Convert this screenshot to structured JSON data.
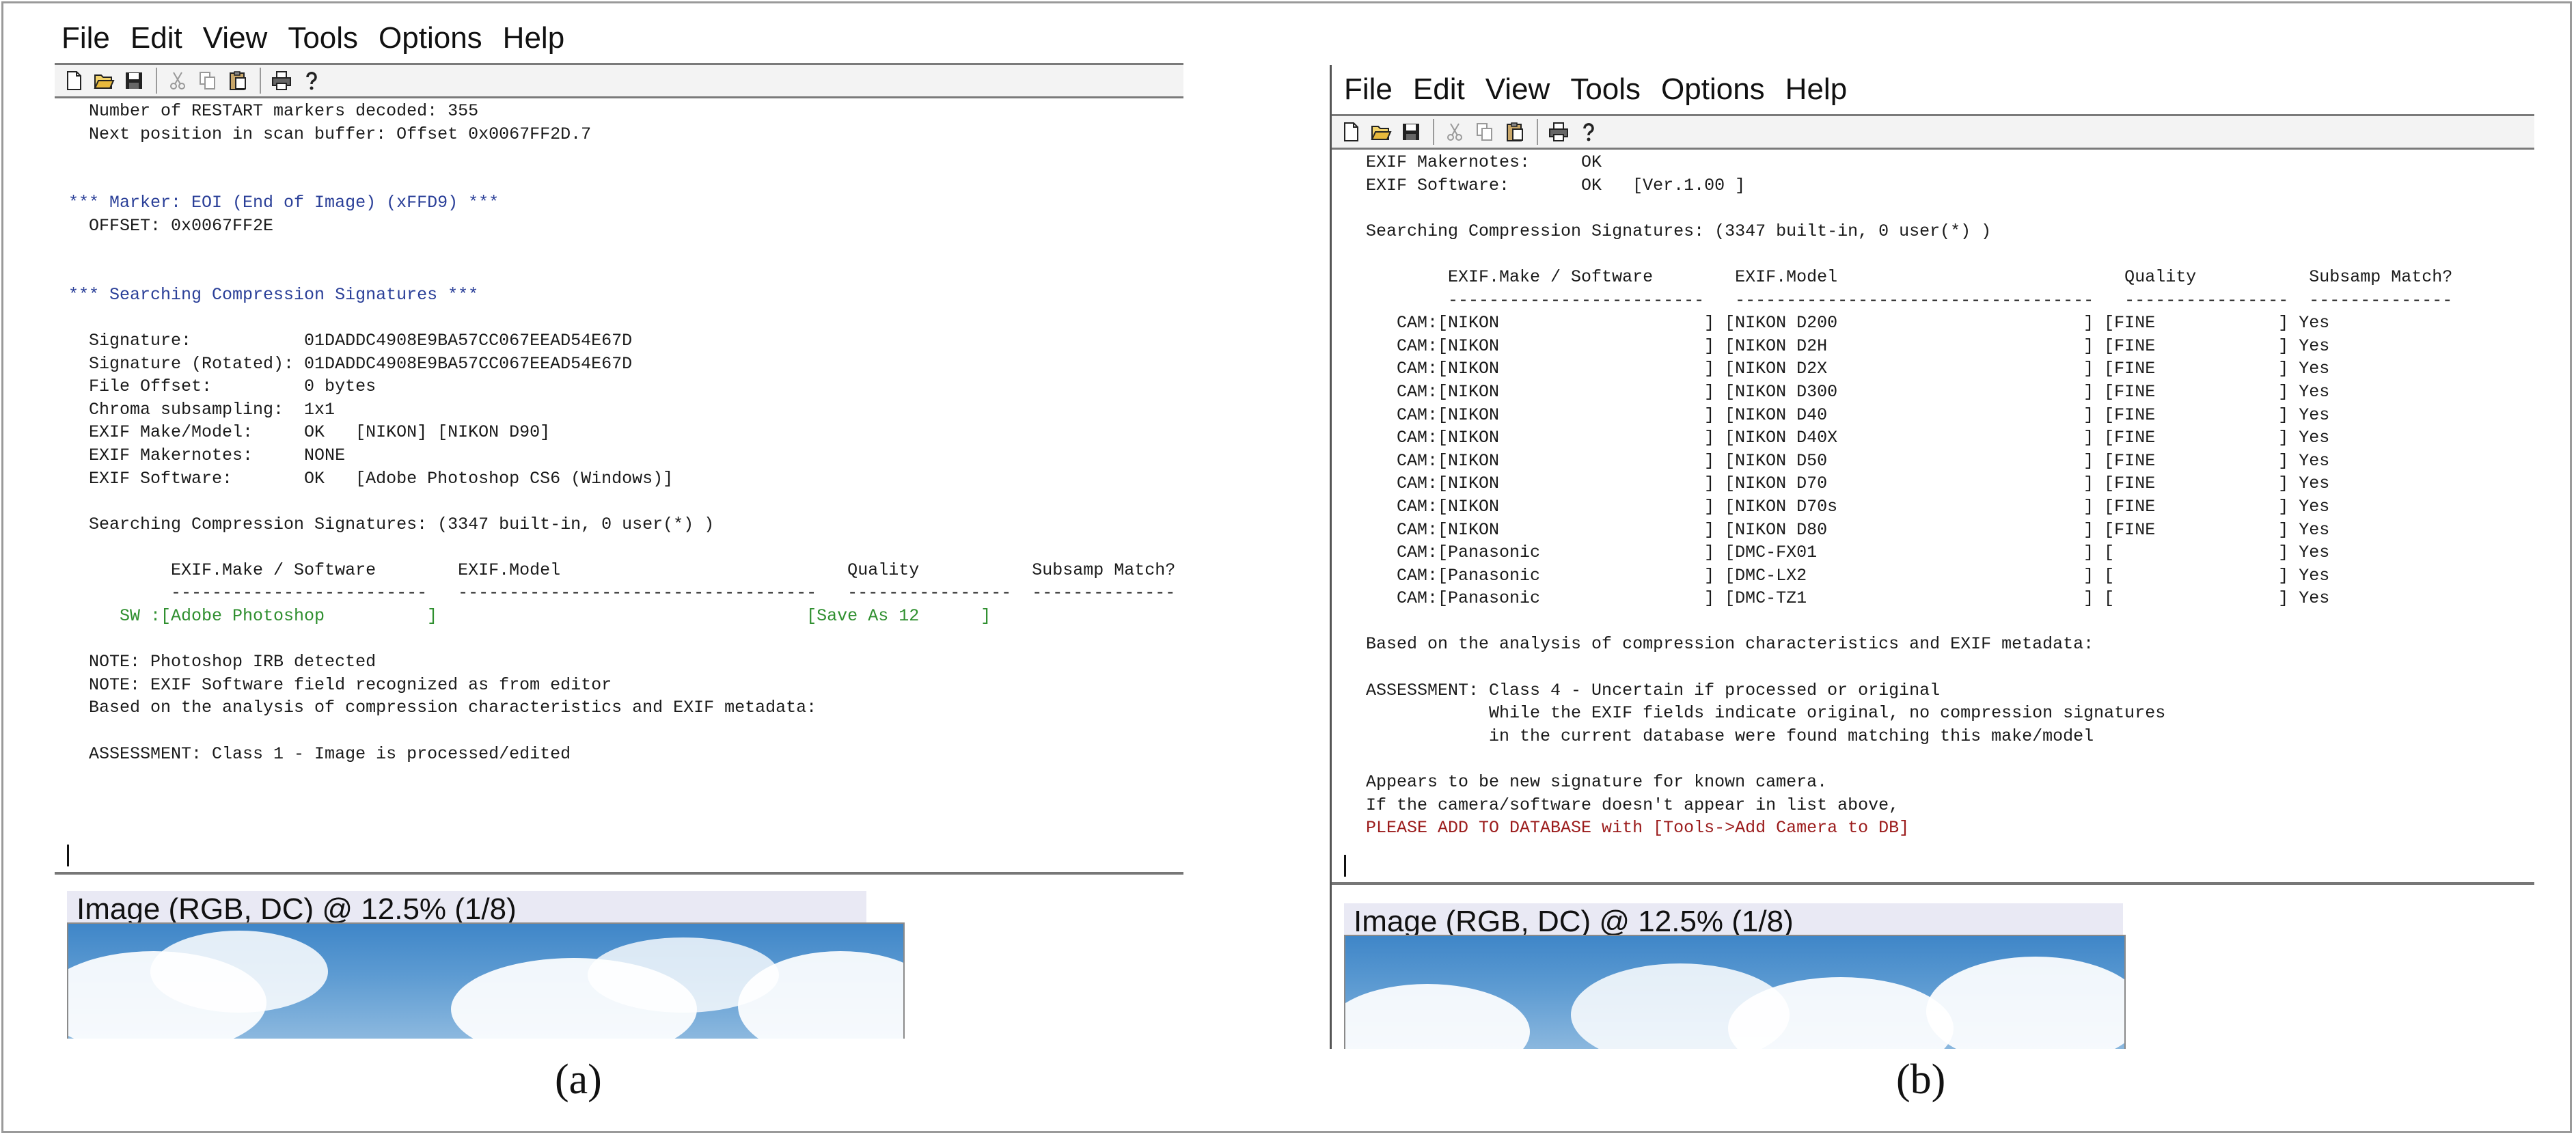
{
  "panels": [
    {
      "menu": [
        "File",
        "Edit",
        "View",
        "Tools",
        "Options",
        "Help"
      ],
      "log": [
        {
          "text": "  Number of RESTART markers decoded: 355",
          "style": "normal"
        },
        {
          "text": "  Next position in scan buffer: Offset 0x0067FF2D.7",
          "style": "normal"
        },
        {
          "text": "",
          "style": "normal"
        },
        {
          "text": "",
          "style": "normal"
        },
        {
          "text": "*** Marker: EOI (End of Image) (xFFD9) ***",
          "style": "marker"
        },
        {
          "text": "  OFFSET: 0x0067FF2E",
          "style": "normal"
        },
        {
          "text": "",
          "style": "normal"
        },
        {
          "text": "",
          "style": "normal"
        },
        {
          "text": "*** Searching Compression Signatures ***",
          "style": "marker"
        },
        {
          "text": "",
          "style": "normal"
        },
        {
          "text": "  Signature:           01DADDC4908E9BA57CC067EEAD54E67D",
          "style": "normal"
        },
        {
          "text": "  Signature (Rotated): 01DADDC4908E9BA57CC067EEAD54E67D",
          "style": "normal"
        },
        {
          "text": "  File Offset:         0 bytes",
          "style": "normal"
        },
        {
          "text": "  Chroma subsampling:  1x1",
          "style": "normal"
        },
        {
          "text": "  EXIF Make/Model:     OK   [NIKON] [NIKON D90]",
          "style": "normal"
        },
        {
          "text": "  EXIF Makernotes:     NONE",
          "style": "normal"
        },
        {
          "text": "  EXIF Software:       OK   [Adobe Photoshop CS6 (Windows)]",
          "style": "normal"
        },
        {
          "text": "",
          "style": "normal"
        },
        {
          "text": "  Searching Compression Signatures: (3347 built-in, 0 user(*) )",
          "style": "normal"
        },
        {
          "text": "",
          "style": "normal"
        },
        {
          "text": "          EXIF.Make / Software        EXIF.Model                            Quality           Subsamp Match?",
          "style": "normal"
        },
        {
          "text": "          -------------------------   -----------------------------------   ----------------  --------------",
          "style": "normal"
        },
        {
          "text": "     SW :[Adobe Photoshop          ]                                    [Save As 12      ]",
          "style": "green"
        },
        {
          "text": "",
          "style": "normal"
        },
        {
          "text": "  NOTE: Photoshop IRB detected",
          "style": "normal"
        },
        {
          "text": "  NOTE: EXIF Software field recognized as from editor",
          "style": "normal"
        },
        {
          "text": "  Based on the analysis of compression characteristics and EXIF metadata:",
          "style": "normal"
        },
        {
          "text": "",
          "style": "normal"
        },
        {
          "text": "  ASSESSMENT: Class 1 - Image is processed/edited",
          "style": "normal"
        }
      ],
      "preview_title": "Image (RGB, DC) @ 12.5% (1/8)",
      "caption": "(a)"
    },
    {
      "menu": [
        "File",
        "Edit",
        "View",
        "Tools",
        "Options",
        "Help"
      ],
      "log": [
        {
          "text": "  EXIF Makernotes:     OK",
          "style": "normal"
        },
        {
          "text": "  EXIF Software:       OK   [Ver.1.00 ]",
          "style": "normal"
        },
        {
          "text": "",
          "style": "normal"
        },
        {
          "text": "  Searching Compression Signatures: (3347 built-in, 0 user(*) )",
          "style": "normal"
        },
        {
          "text": "",
          "style": "normal"
        },
        {
          "text": "          EXIF.Make / Software        EXIF.Model                            Quality           Subsamp Match?",
          "style": "normal"
        },
        {
          "text": "          -------------------------   -----------------------------------   ----------------  --------------",
          "style": "normal"
        },
        {
          "text": "     CAM:[NIKON                    ] [NIKON D200                        ] [FINE            ] Yes",
          "style": "normal"
        },
        {
          "text": "     CAM:[NIKON                    ] [NIKON D2H                         ] [FINE            ] Yes",
          "style": "normal"
        },
        {
          "text": "     CAM:[NIKON                    ] [NIKON D2X                         ] [FINE            ] Yes",
          "style": "normal"
        },
        {
          "text": "     CAM:[NIKON                    ] [NIKON D300                        ] [FINE            ] Yes",
          "style": "normal"
        },
        {
          "text": "     CAM:[NIKON                    ] [NIKON D40                         ] [FINE            ] Yes",
          "style": "normal"
        },
        {
          "text": "     CAM:[NIKON                    ] [NIKON D40X                        ] [FINE            ] Yes",
          "style": "normal"
        },
        {
          "text": "     CAM:[NIKON                    ] [NIKON D50                         ] [FINE            ] Yes",
          "style": "normal"
        },
        {
          "text": "     CAM:[NIKON                    ] [NIKON D70                         ] [FINE            ] Yes",
          "style": "normal"
        },
        {
          "text": "     CAM:[NIKON                    ] [NIKON D70s                        ] [FINE            ] Yes",
          "style": "normal"
        },
        {
          "text": "     CAM:[NIKON                    ] [NIKON D80                         ] [FINE            ] Yes",
          "style": "normal"
        },
        {
          "text": "     CAM:[Panasonic                ] [DMC-FX01                          ] [                ] Yes",
          "style": "normal"
        },
        {
          "text": "     CAM:[Panasonic                ] [DMC-LX2                           ] [                ] Yes",
          "style": "normal"
        },
        {
          "text": "     CAM:[Panasonic                ] [DMC-TZ1                           ] [                ] Yes",
          "style": "normal"
        },
        {
          "text": "",
          "style": "normal"
        },
        {
          "text": "  Based on the analysis of compression characteristics and EXIF metadata:",
          "style": "normal"
        },
        {
          "text": "",
          "style": "normal"
        },
        {
          "text": "  ASSESSMENT: Class 4 - Uncertain if processed or original",
          "style": "normal"
        },
        {
          "text": "              While the EXIF fields indicate original, no compression signatures",
          "style": "normal"
        },
        {
          "text": "              in the current database were found matching this make/model",
          "style": "normal"
        },
        {
          "text": "",
          "style": "normal"
        },
        {
          "text": "  Appears to be new signature for known camera.",
          "style": "normal"
        },
        {
          "text": "  If the camera/software doesn't appear in list above,",
          "style": "normal"
        },
        {
          "text": "  PLEASE ADD TO DATABASE with [Tools->Add Camera to DB]",
          "style": "red"
        }
      ],
      "preview_title": "Image (RGB, DC) @ 12.5% (1/8)",
      "caption": "(b)"
    }
  ],
  "toolbar_icons": [
    "new-file-icon",
    "open-folder-icon",
    "save-icon",
    "cut-icon",
    "copy-icon",
    "paste-icon",
    "print-icon",
    "help-icon"
  ]
}
